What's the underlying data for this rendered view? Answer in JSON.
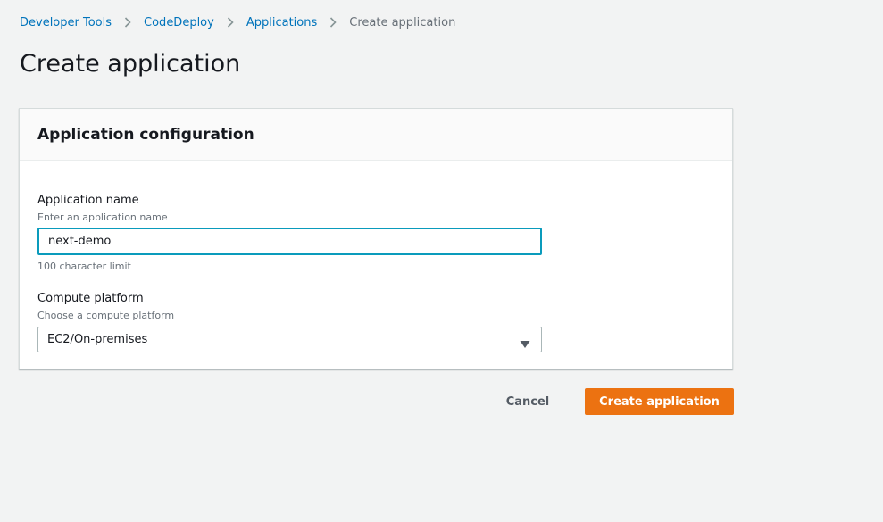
{
  "breadcrumb": {
    "items": [
      {
        "label": "Developer Tools"
      },
      {
        "label": "CodeDeploy"
      },
      {
        "label": "Applications"
      }
    ],
    "current": "Create application"
  },
  "page": {
    "title": "Create application"
  },
  "panel": {
    "title": "Application configuration",
    "app_name": {
      "label": "Application name",
      "description": "Enter an application name",
      "value": "next-demo",
      "constraint": "100 character limit"
    },
    "compute_platform": {
      "label": "Compute platform",
      "description": "Choose a compute platform",
      "selected": "EC2/On-premises"
    }
  },
  "actions": {
    "cancel_label": "Cancel",
    "create_label": "Create application"
  },
  "colors": {
    "link": "#0073bb",
    "primary_button": "#ec7211",
    "focus_border": "#0a9bbc",
    "background": "#f2f3f3"
  },
  "icons": {
    "separator": "chevron-right-icon",
    "dropdown": "caret-down-icon"
  }
}
